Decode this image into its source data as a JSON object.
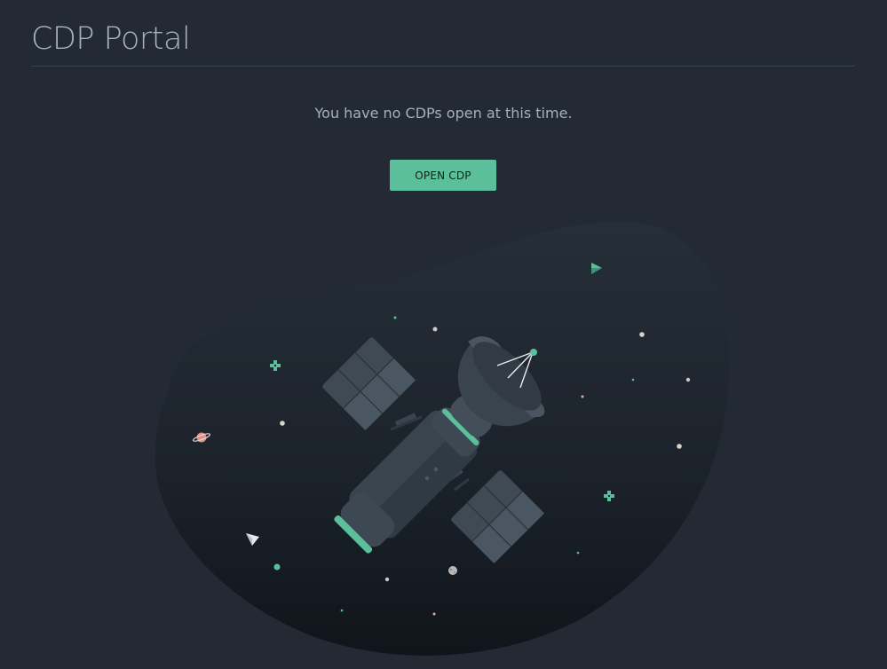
{
  "header": {
    "title": "CDP Portal"
  },
  "empty_state": {
    "message": "You have no CDPs open at this time.",
    "button_label": "OPEN CDP"
  },
  "colors": {
    "background": "#232a34",
    "accent": "#5cbf9c",
    "title_text": "#a9b1bb",
    "body_text": "#a7afb8"
  },
  "icons": [
    "satellite-illustration",
    "planet-icon",
    "paper-plane-icon",
    "play-arrow-icon",
    "sparkle-icon",
    "moon-icon"
  ]
}
